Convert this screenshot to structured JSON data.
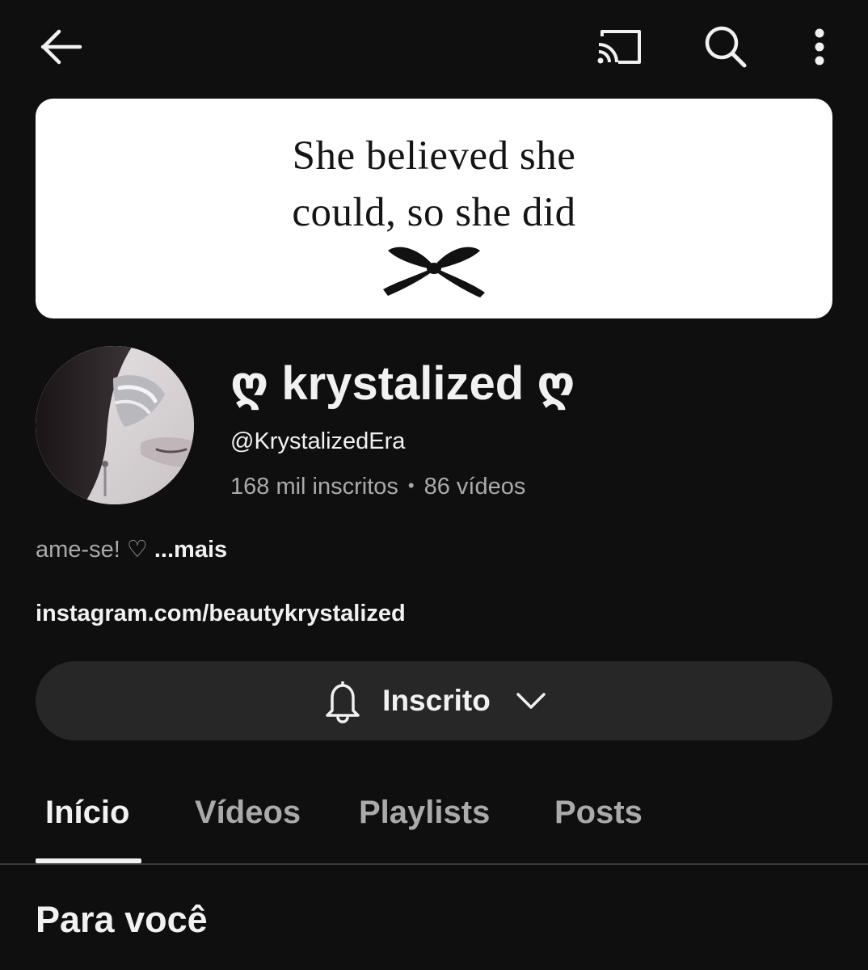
{
  "topbar": {
    "back_icon": "arrow-left-icon",
    "cast_icon": "cast-icon",
    "search_icon": "search-icon",
    "more_icon": "more-vertical-icon"
  },
  "banner": {
    "line1": "She believed she",
    "line2": "could, so she did",
    "decoration_icon": "bow-icon"
  },
  "channel": {
    "name": "ღ krystalized ღ",
    "handle": "@KrystalizedEra",
    "subscribers": "168 mil inscritos",
    "separator": "•",
    "videos": "86 vídeos",
    "description": "ame-se! ♡ ",
    "more_label": "...mais",
    "link": "instagram.com/beautykrystalized"
  },
  "subscribe": {
    "label": "Inscrito",
    "bell_icon": "bell-icon",
    "chevron_icon": "chevron-down-icon"
  },
  "tabs": [
    {
      "label": "Início",
      "active": true
    },
    {
      "label": "Vídeos",
      "active": false
    },
    {
      "label": "Playlists",
      "active": false
    },
    {
      "label": "Posts",
      "active": false
    }
  ],
  "section": {
    "title": "Para você"
  },
  "colors": {
    "background": "#0f0f0f",
    "text": "#f1f1f1",
    "secondary_text": "#aaaaaa",
    "button_bg": "#272727"
  }
}
